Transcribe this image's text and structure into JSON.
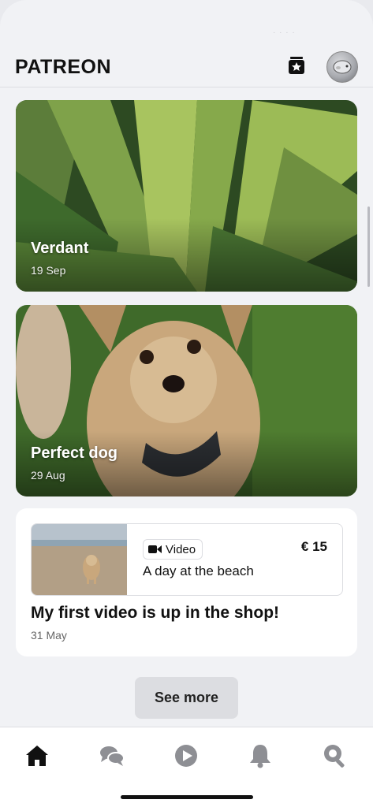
{
  "header": {
    "logo": "PATREON"
  },
  "posts": [
    {
      "title": "Verdant",
      "date": "19 Sep"
    },
    {
      "title": "Perfect dog",
      "date": "29 Aug"
    }
  ],
  "shop_post": {
    "product_type": "Video",
    "product_price": "€ 15",
    "product_title": "A day at the beach",
    "title": "My first video is up in the shop!",
    "date": "31 May"
  },
  "see_more_label": "See more",
  "tabs": [
    "home-icon",
    "chat-icon",
    "play-icon",
    "bell-icon",
    "search-icon"
  ],
  "colors": {
    "accent": "#111111",
    "inactive": "#8e8f94",
    "background": "#f1f2f5"
  }
}
